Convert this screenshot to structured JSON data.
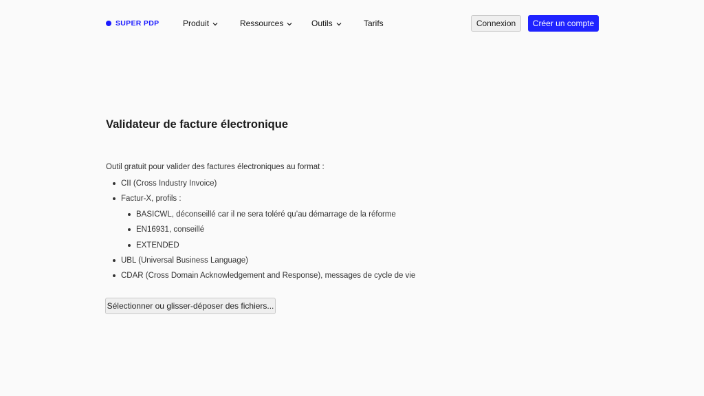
{
  "header": {
    "logo_text": "SUPER PDP",
    "menu": [
      {
        "label": "Produit",
        "has_dropdown": true
      },
      {
        "label": "Ressources",
        "has_dropdown": true
      },
      {
        "label": "Outils",
        "has_dropdown": true
      },
      {
        "label": "Tarifs",
        "has_dropdown": false
      }
    ],
    "login_label": "Connexion",
    "signup_label": "Créer un compte"
  },
  "main": {
    "title": "Validateur de facture électronique",
    "intro": "Outil gratuit pour valider des factures électroniques au format :",
    "formats": {
      "cii": "CII (Cross Industry Invoice)",
      "facturx": "Factur-X, profils :",
      "facturx_profiles": [
        "BASICWL, déconseillé car il ne sera toléré qu’au démarrage de la réforme",
        "EN16931, conseillé",
        "EXTENDED"
      ],
      "ubl": "UBL (Universal Business Language)",
      "cdar": "CDAR (Cross Domain Acknowledgement and Response), messages de cycle de vie"
    },
    "file_button_label": "Sélectionner ou glisser-déposer des fichiers..."
  },
  "colors": {
    "brand": "#1a1aff",
    "primary_button": "#1f23ff",
    "background": "#fafafa"
  }
}
